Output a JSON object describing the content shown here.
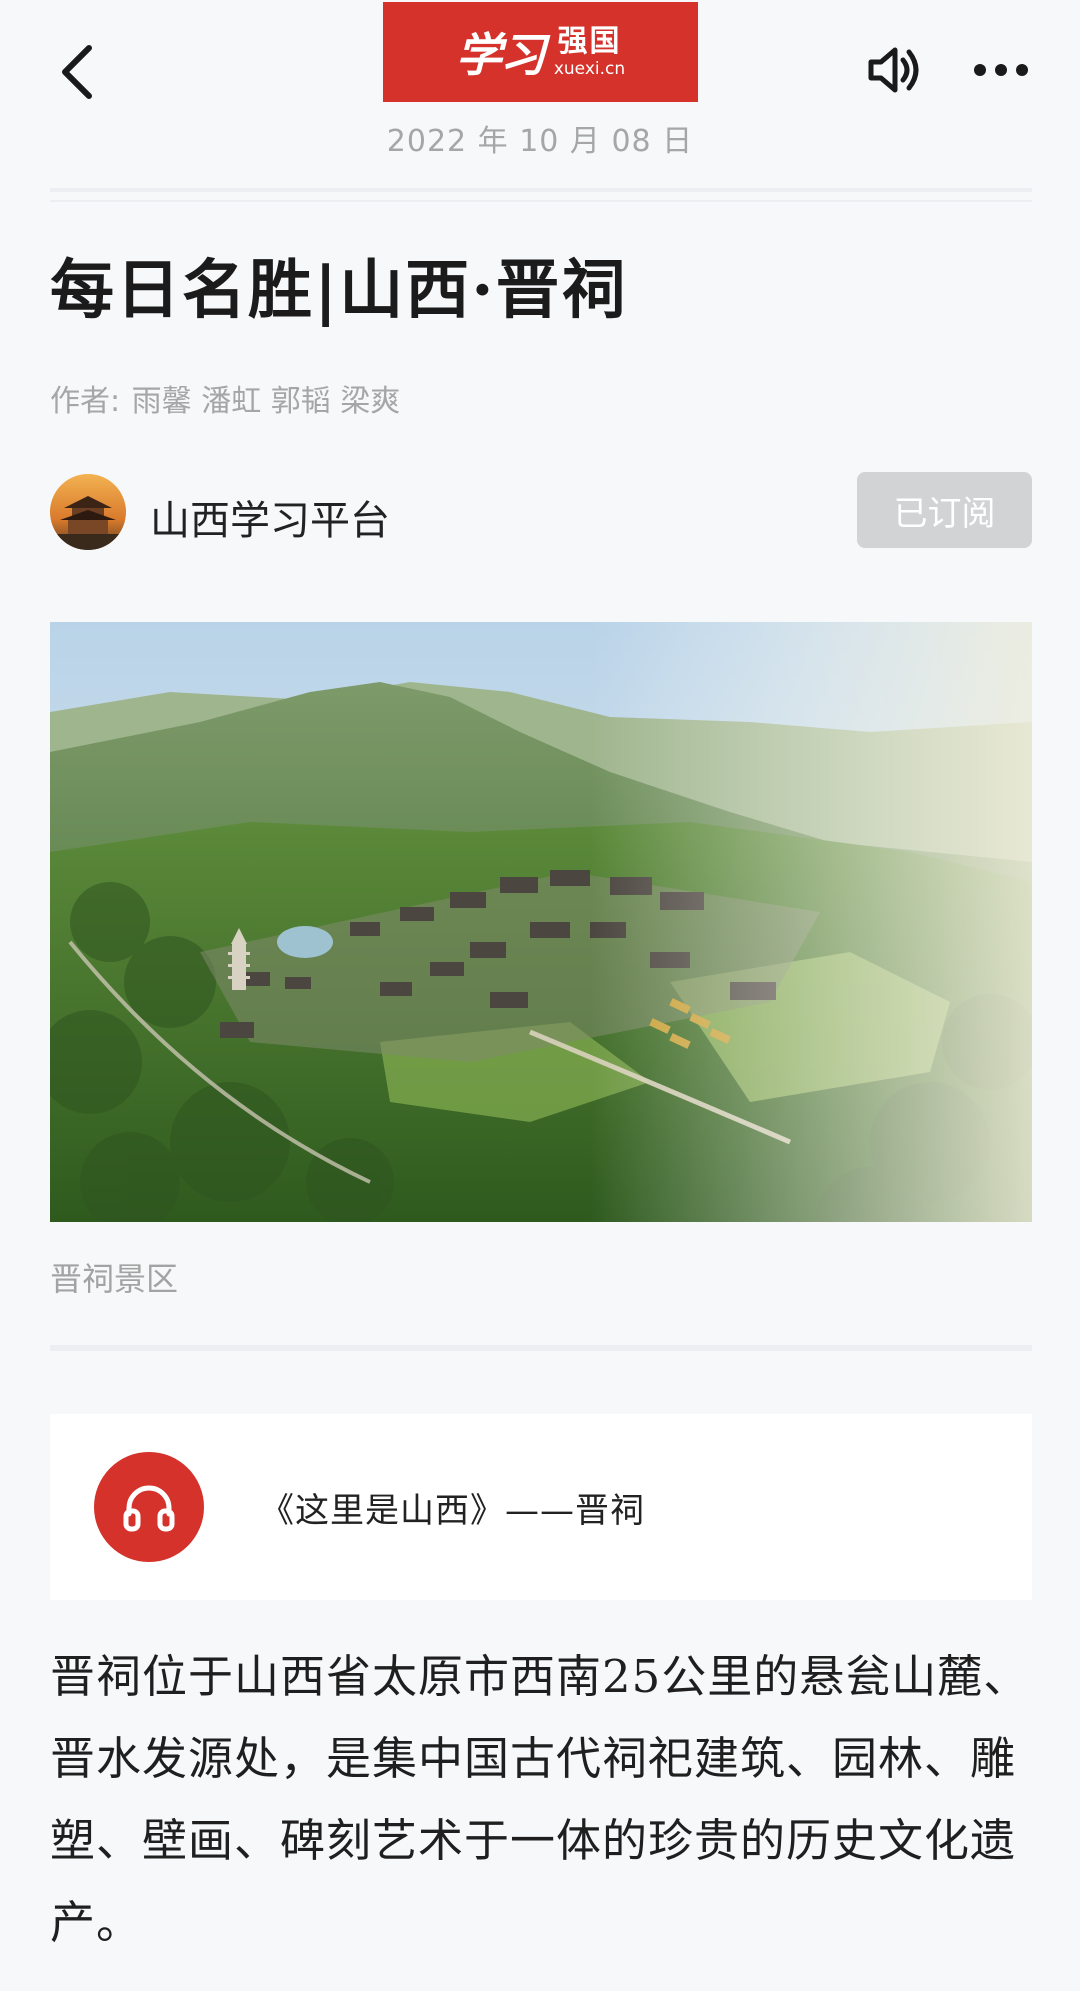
{
  "header": {
    "logo_script": "学习",
    "logo_cn": "强国",
    "logo_en": "xuexi.cn",
    "date": "2022 年 10 月 08 日",
    "icons": {
      "back": "back-arrow-icon",
      "speaker": "speaker-icon",
      "more": "more-icon"
    }
  },
  "article": {
    "title": "每日名胜|山西·晋祠",
    "author_label": "作者:",
    "authors": "雨馨 潘虹 郭韬 梁爽",
    "channel": {
      "name": "山西学习平台",
      "subscribe_label": "已订阅"
    },
    "image_caption": "晋祠景区",
    "audio": {
      "title": "《这里是山西》——晋祠",
      "icon": "headphones-icon"
    },
    "body": "晋祠位于山西省太原市西南25公里的悬瓮山麓、晋水发源处，是集中国古代祠祀建筑、园林、雕塑、壁画、碑刻艺术于一体的珍贵的历史文化遗产。"
  },
  "colors": {
    "brand_red": "#d4322a",
    "background": "#f7f8fa",
    "muted_text": "#a6a6a6",
    "subscribed_button": "#d2d3d5"
  }
}
